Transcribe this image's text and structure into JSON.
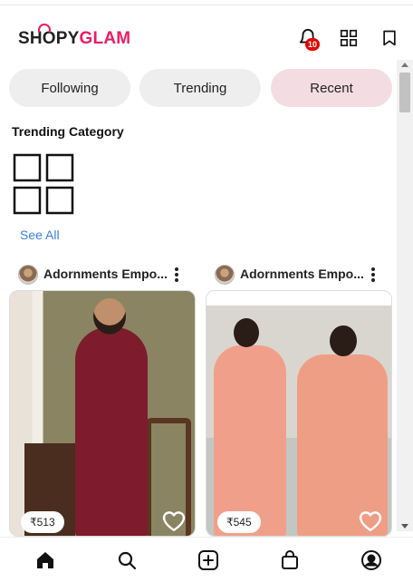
{
  "app": {
    "logo_part1": "SH",
    "logo_part2": "OPY",
    "logo_part3": "GLAM",
    "brand_color": "#e91e63",
    "notification_count": "10"
  },
  "header": {
    "icons": [
      "bell-icon",
      "grid-icon",
      "bookmark-icon"
    ]
  },
  "tabs": [
    {
      "label": "Following",
      "active": false
    },
    {
      "label": "Trending",
      "active": false
    },
    {
      "label": "Recent",
      "active": true
    }
  ],
  "category": {
    "title": "Trending Category",
    "see_all": "See All",
    "icon": "grid-icon"
  },
  "posts": [
    {
      "seller": "Adornments Empo...",
      "price": "₹513",
      "image": "maroon-kurta-dress-photo"
    },
    {
      "seller": "Adornments Empo...",
      "price": "₹545",
      "image": "peach-floral-anarkali-photo"
    }
  ],
  "bottom_nav": [
    "home-icon",
    "search-icon",
    "add-icon",
    "bag-icon",
    "profile-icon"
  ],
  "colors": {
    "active_tab": "#f3dde2",
    "inactive_tab": "#eeeeee",
    "link": "#3b7ddd",
    "badge": "#e10600"
  }
}
